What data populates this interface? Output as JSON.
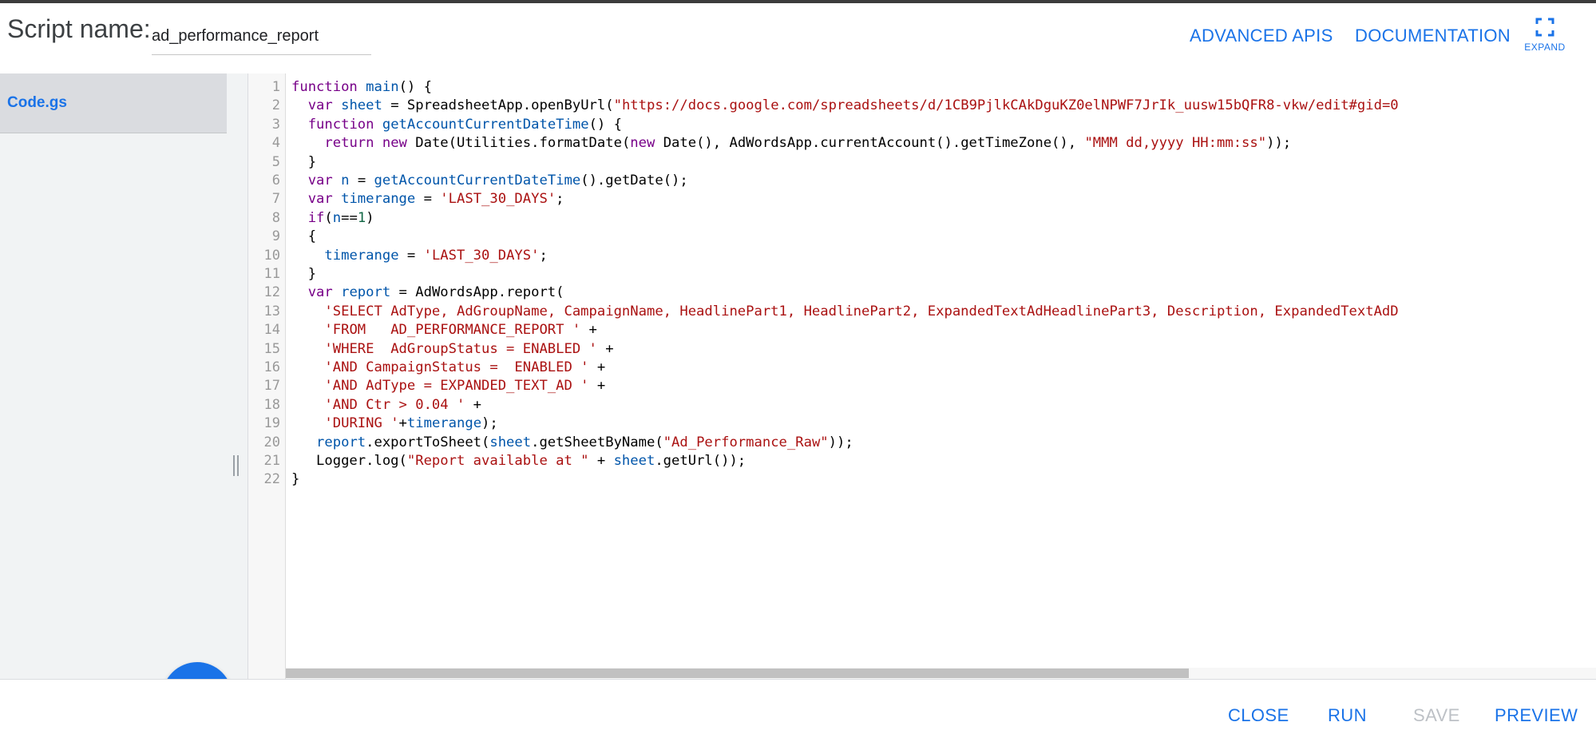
{
  "header": {
    "script_label": "Script name:",
    "script_name_value": "ad_performance_report",
    "advanced_apis": "ADVANCED APIS",
    "documentation": "DOCUMENTATION",
    "expand_label": "EXPAND",
    "expand_icon": "fullscreen-icon"
  },
  "sidebar": {
    "files": [
      {
        "label": "Code.gs"
      }
    ],
    "add_icon": "plus-icon"
  },
  "editor": {
    "line_numbers": [
      "1",
      "2",
      "3",
      "4",
      "5",
      "6",
      "7",
      "8",
      "9",
      "10",
      "11",
      "12",
      "13",
      "14",
      "15",
      "16",
      "17",
      "18",
      "19",
      "20",
      "21",
      "22"
    ],
    "lines": [
      "function main() {",
      "  var sheet = SpreadsheetApp.openByUrl(\"https://docs.google.com/spreadsheets/d/1CB9PjlkCAkDguKZ0elNPWF7JrIk_uusw15bQFR8-vkw/edit#gid=0",
      "  function getAccountCurrentDateTime() {",
      "    return new Date(Utilities.formatDate(new Date(), AdWordsApp.currentAccount().getTimeZone(), \"MMM dd,yyyy HH:mm:ss\"));",
      "  }",
      "  var n = getAccountCurrentDateTime().getDate();",
      "  var timerange = 'LAST_30_DAYS';",
      "  if(n==1)",
      "  {",
      "    timerange = 'LAST_30_DAYS';",
      "  }",
      "  var report = AdWordsApp.report(",
      "    'SELECT AdType, AdGroupName, CampaignName, HeadlinePart1, HeadlinePart2, ExpandedTextAdHeadlinePart3, Description, ExpandedTextAdD",
      "    'FROM   AD_PERFORMANCE_REPORT ' +",
      "    'WHERE  AdGroupStatus = ENABLED ' +",
      "    'AND CampaignStatus =  ENABLED ' +",
      "    'AND AdType = EXPANDED_TEXT_AD ' +",
      "    'AND Ctr > 0.04 ' +",
      "    'DURING '+timerange);",
      "   report.exportToSheet(sheet.getSheetByName(\"Ad_Performance_Raw\"));",
      "   Logger.log(\"Report available at \" + sheet.getUrl());",
      "}"
    ]
  },
  "footer": {
    "close": "CLOSE",
    "run": "RUN",
    "save": "SAVE",
    "preview": "PREVIEW"
  },
  "colors": {
    "accent": "#1a73e8",
    "disabled": "#bdc1c6",
    "keyword": "#770088",
    "variable": "#0000ff",
    "string": "#aa1111",
    "number": "#116644"
  }
}
